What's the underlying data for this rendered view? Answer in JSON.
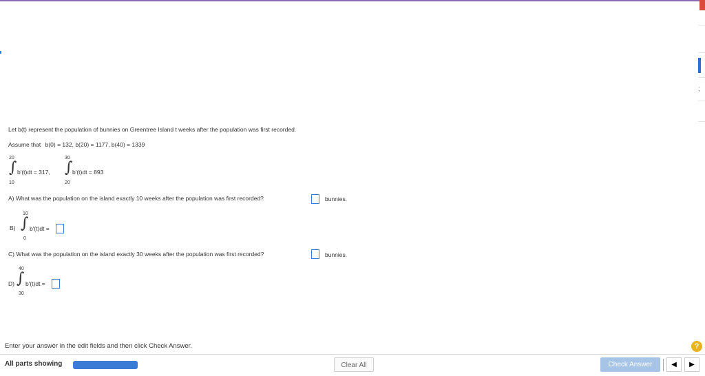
{
  "problem": {
    "intro": "Let b(t) represent the population of bunnies on Greentree Island t weeks after the population was first recorded.",
    "assume_label": "Assume that",
    "assume_values": "b(0) = 132,   b(20) = 1177,   b(40) = 1339",
    "given_integrals": [
      {
        "upper": "20",
        "lower": "10",
        "expr": "b′(t)dt = 317,"
      },
      {
        "upper": "30",
        "lower": "20",
        "expr": "b′(t)dt = 893"
      }
    ],
    "part_a": {
      "text": "A) What was the population on the island exactly 10 weeks after the population was first recorded?",
      "unit": "bunnies."
    },
    "part_b": {
      "label": "B)",
      "upper": "10",
      "lower": "0",
      "expr": "b′(t)dt ="
    },
    "part_c": {
      "text": "C) What was the population on the island exactly 30 weeks after the population was first recorded?",
      "unit": "bunnies."
    },
    "part_d": {
      "label": "D)",
      "upper": "40",
      "lower": "30",
      "expr": "b′(t)dt ="
    }
  },
  "footer": {
    "hint": "Enter your answer in the edit fields and then click Check Answer.",
    "help_label": "?",
    "parts_label": "All parts showing",
    "progress": 1.0,
    "clear_label": "Clear All",
    "check_label": "Check Answer",
    "prev_label": "◀",
    "next_label": "▶"
  },
  "colors": {
    "accent": "#3a7bd5",
    "check_button": "#a6c4e6",
    "help": "#e8b321",
    "topbar": "#8b6bb8"
  }
}
